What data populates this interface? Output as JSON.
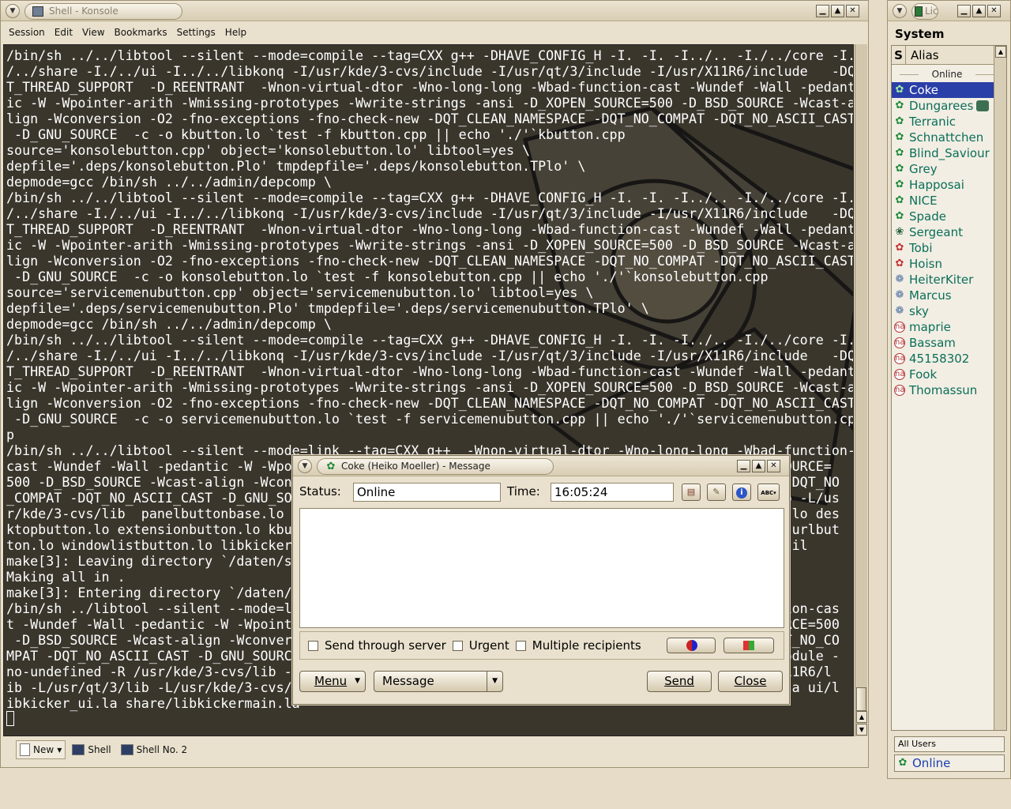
{
  "konsole": {
    "title": "Shell - Konsole",
    "menu": [
      "Session",
      "Edit",
      "View",
      "Bookmarks",
      "Settings",
      "Help"
    ],
    "terminal_lines": [
      "/bin/sh ../../libtool --silent --mode=compile --tag=CXX g++ -DHAVE_CONFIG_H -I. -I. -I../.. -I./../core -I.",
      "/../share -I./../ui -I../../libkonq -I/usr/kde/3-cvs/include -I/usr/qt/3/include -I/usr/X11R6/include   -DQ",
      "T_THREAD_SUPPORT  -D_REENTRANT  -Wnon-virtual-dtor -Wno-long-long -Wbad-function-cast -Wundef -Wall -pedant",
      "ic -W -Wpointer-arith -Wmissing-prototypes -Wwrite-strings -ansi -D_XOPEN_SOURCE=500 -D_BSD_SOURCE -Wcast-a",
      "lign -Wconversion -O2 -fno-exceptions -fno-check-new -DQT_CLEAN_NAMESPACE -DQT_NO_COMPAT -DQT_NO_ASCII_CAST",
      " -D_GNU_SOURCE  -c -o kbutton.lo `test -f kbutton.cpp || echo './'`kbutton.cpp",
      "source='konsolebutton.cpp' object='konsolebutton.lo' libtool=yes \\",
      "depfile='.deps/konsolebutton.Plo' tmpdepfile='.deps/konsolebutton.TPlo' \\",
      "depmode=gcc /bin/sh ../../admin/depcomp \\",
      "/bin/sh ../../libtool --silent --mode=compile --tag=CXX g++ -DHAVE_CONFIG_H -I. -I. -I../.. -I./../core -I.",
      "/../share -I./../ui -I../../libkonq -I/usr/kde/3-cvs/include -I/usr/qt/3/include -I/usr/X11R6/include   -DQ",
      "T_THREAD_SUPPORT  -D_REENTRANT  -Wnon-virtual-dtor -Wno-long-long -Wbad-function-cast -Wundef -Wall -pedant",
      "ic -W -Wpointer-arith -Wmissing-prototypes -Wwrite-strings -ansi -D_XOPEN_SOURCE=500 -D_BSD_SOURCE -Wcast-a",
      "lign -Wconversion -O2 -fno-exceptions -fno-check-new -DQT_CLEAN_NAMESPACE -DQT_NO_COMPAT -DQT_NO_ASCII_CAST",
      " -D_GNU_SOURCE  -c -o konsolebutton.lo `test -f konsolebutton.cpp || echo './'`konsolebutton.cpp",
      "source='servicemenubutton.cpp' object='servicemenubutton.lo' libtool=yes \\",
      "depfile='.deps/servicemenubutton.Plo' tmpdepfile='.deps/servicemenubutton.TPlo' \\",
      "depmode=gcc /bin/sh ../../admin/depcomp \\",
      "/bin/sh ../../libtool --silent --mode=compile --tag=CXX g++ -DHAVE_CONFIG_H -I. -I. -I../.. -I./../core -I.",
      "/../share -I./../ui -I../../libkonq -I/usr/kde/3-cvs/include -I/usr/qt/3/include -I/usr/X11R6/include   -DQ",
      "T_THREAD_SUPPORT  -D_REENTRANT  -Wnon-virtual-dtor -Wno-long-long -Wbad-function-cast -Wundef -Wall -pedant",
      "ic -W -Wpointer-arith -Wmissing-prototypes -Wwrite-strings -ansi -D_XOPEN_SOURCE=500 -D_BSD_SOURCE -Wcast-a",
      "lign -Wconversion -O2 -fno-exceptions -fno-check-new -DQT_CLEAN_NAMESPACE -DQT_NO_COMPAT -DQT_NO_ASCII_CAST",
      " -D_GNU_SOURCE  -c -o servicemenubutton.lo `test -f servicemenubutton.cpp || echo './'`servicemenubutton.cp",
      "p",
      "/bin/sh ../../libtool --silent --mode=link --tag=CXX g++  -Wnon-virtual-dtor -Wno-long-long -Wbad-function-",
      "cast -Wundef -Wall -pedantic -W -Wpo                                                             SOURCE=",
      "500 -D_BSD_SOURCE -Wcast-align -Wcon                                                              -DQT_NO",
      "_COMPAT -DQT_NO_ASCII_CAST -D_GNU_SOU                                                            ib -L/us",
      "r/kde/3-cvs/lib  panelbuttonbase.lo                                                              n.lo des",
      "ktopbutton.lo extensionbutton.lo kbut                                                            o urlbut",
      "ton.lo windowlistbutton.lo libkicker                                                             util",
      "make[3]: Leaving directory `/daten/s",
      "Making all in .",
      "make[3]: Entering directory `/daten/s",
      "/bin/sh ../libtool --silent --mode=li                                                            tion-cas",
      "t -Wundef -Wall -pedantic -W -Wpointe                                                            URCE=500",
      " -D_BSD_SOURCE -Wcast-align -Wconvers                                                            QT_NO_CO",
      "MPAT -DQT_NO_ASCII_CAST -D_GNU_SOURC                                                             module -",
      "no-undefined -R /usr/kde/3-cvs/lib -                                                             X11R6/l",
      "ib -L/usr/qt/3/lib -L/usr/kde/3-cvs/                                                             .la ui/l",
      "ibkicker_ui.la share/libkickermain.la"
    ],
    "tabs": {
      "new_label": "New",
      "items": [
        "Shell",
        "Shell No. 2"
      ]
    }
  },
  "licq": {
    "title": "Lic",
    "system_label": "System",
    "header_s": "S",
    "header_alias": "Alias",
    "group_online": "Online",
    "contacts": [
      {
        "name": "Coke",
        "icon": "flower",
        "selected": true
      },
      {
        "name": "Dungarees",
        "icon": "flower"
      },
      {
        "name": "Terranic",
        "icon": "flower"
      },
      {
        "name": "Schnattchen",
        "icon": "flower"
      },
      {
        "name": "Blind_Saviour",
        "icon": "flower"
      },
      {
        "name": "Grey",
        "icon": "flower"
      },
      {
        "name": "Happosai",
        "icon": "flower"
      },
      {
        "name": "NICE",
        "icon": "flower"
      },
      {
        "name": "Spade",
        "icon": "flower"
      },
      {
        "name": "Sergeant",
        "icon": "flower-alt"
      },
      {
        "name": "Tobi",
        "icon": "occupied"
      },
      {
        "name": "Hoisn",
        "icon": "occupied"
      },
      {
        "name": "HeiterKiter",
        "icon": "away"
      },
      {
        "name": "Marcus",
        "icon": "away"
      },
      {
        "name": "sky",
        "icon": "away"
      },
      {
        "name": "maprie",
        "icon": "na"
      },
      {
        "name": "Bassam",
        "icon": "na"
      },
      {
        "name": "45158302",
        "icon": "na"
      },
      {
        "name": "Fook",
        "icon": "na"
      },
      {
        "name": "Thomassun",
        "icon": "na"
      }
    ],
    "group_combo": "All Users",
    "status_combo": "Online"
  },
  "message": {
    "title": "Coke (Heiko Moeller) - Message",
    "status_label": "Status:",
    "status_value": "Online",
    "time_label": "Time:",
    "time_value": "16:05:24",
    "opt_server": "Send through server",
    "opt_urgent": "Urgent",
    "opt_multiple": "Multiple recipients",
    "menu_button": "Menu",
    "type_combo": "Message",
    "send_button": "Send",
    "close_button": "Close"
  },
  "colors": {
    "terminal_bg": "#3a362c",
    "selection": "#2b3fa8",
    "contact_text": "#0b6e5a",
    "window_bg": "#e9e1cd"
  }
}
